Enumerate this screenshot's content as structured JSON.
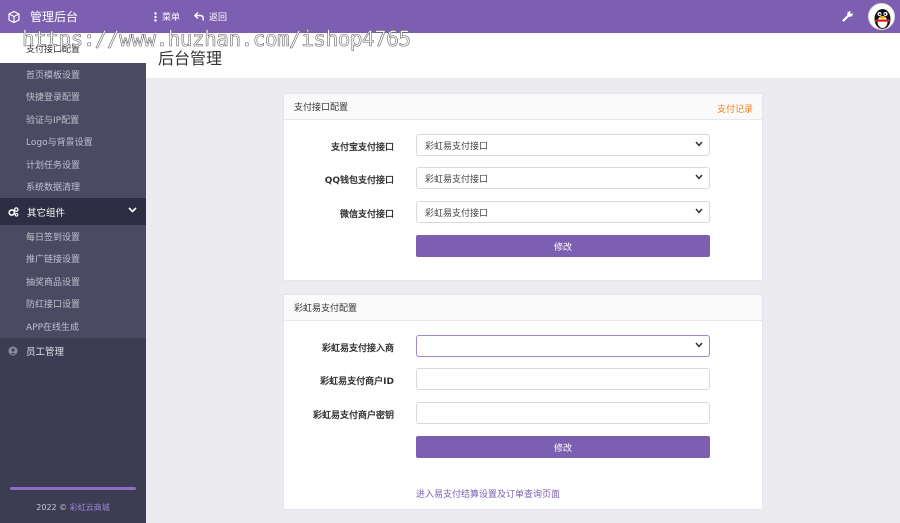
{
  "topbar": {
    "brand_title": "管理后台",
    "menu_label": "菜单",
    "back_label": "返回"
  },
  "watermark": "https://www.huzhan.com/ishop4765",
  "sidebar": {
    "items_top": [
      {
        "label": "支付接口配置",
        "active": true
      },
      {
        "label": "首页模板设置"
      },
      {
        "label": "快捷登录配置"
      },
      {
        "label": "验证与IP配置"
      },
      {
        "label": "Logo与背景设置"
      },
      {
        "label": "计划任务设置"
      },
      {
        "label": "系统数据清理"
      }
    ],
    "group_other": "其它组件",
    "items_other": [
      {
        "label": "每日签到设置"
      },
      {
        "label": "推广链接设置"
      },
      {
        "label": "抽奖商品设置"
      },
      {
        "label": "防红接口设置"
      },
      {
        "label": "APP在线生成"
      }
    ],
    "group_staff": "员工管理",
    "copyright_year": "2022 ©",
    "copyright_brand": "彩虹云商城"
  },
  "page": {
    "title": "后台管理"
  },
  "panel_pay": {
    "title": "支付接口配置",
    "records_link": "支付记录",
    "fields": [
      {
        "label": "支付宝支付接口",
        "value": "彩虹易支付接口"
      },
      {
        "label": "QQ钱包支付接口",
        "value": "彩虹易支付接口"
      },
      {
        "label": "微信支付接口",
        "value": "彩虹易支付接口"
      }
    ],
    "submit": "修改"
  },
  "panel_epay": {
    "title": "彩虹易支付配置",
    "fields": [
      {
        "label": "彩虹易支付接入商",
        "value": ""
      },
      {
        "label": "彩虹易支付商户ID",
        "value": ""
      },
      {
        "label": "彩虹易支付商户密钥",
        "value": ""
      }
    ],
    "submit": "修改",
    "footer_link": "进入易支付结算设置及订单查询页面"
  },
  "colors": {
    "accent": "#7d5fb2",
    "sidebar": "#3c3d53",
    "link_orange": "#f0811a"
  },
  "icons": {
    "brand": "cube-icon",
    "menu": "vertical-dots-icon",
    "back": "back-arrow-icon",
    "settings": "wrench-icon",
    "avatar": "qq-penguin-avatar",
    "group_other": "gears-icon",
    "group_staff": "user-circle-icon",
    "expand": "chevron-down-icon",
    "select": "chevron-down-icon"
  }
}
